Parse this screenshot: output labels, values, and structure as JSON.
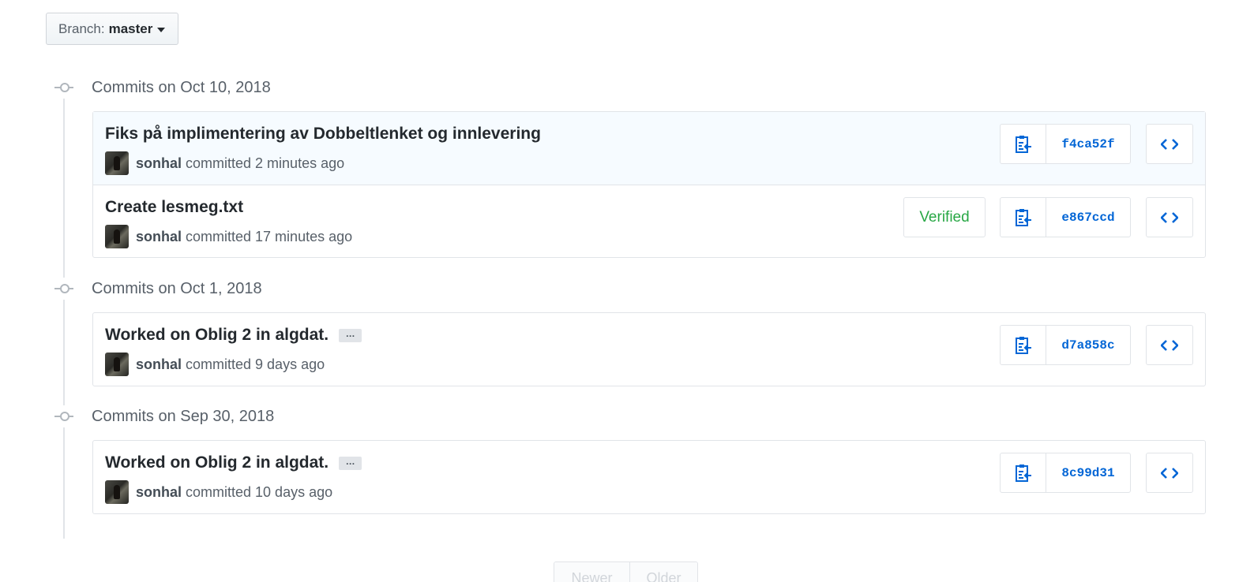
{
  "branch": {
    "label": "Branch:",
    "value": "master"
  },
  "groups": [
    {
      "date": "Commits on Oct 10, 2018",
      "commits": [
        {
          "title": "Fiks på implimentering av Dobbeltlenket og innlevering",
          "author": "sonhal",
          "time": "committed 2 minutes ago",
          "sha": "f4ca52f",
          "verified": "",
          "has_more": false
        },
        {
          "title": "Create lesmeg.txt",
          "author": "sonhal",
          "time": "committed 17 minutes ago",
          "sha": "e867ccd",
          "verified": "Verified",
          "has_more": false
        }
      ]
    },
    {
      "date": "Commits on Oct 1, 2018",
      "commits": [
        {
          "title": "Worked on Oblig 2 in algdat.",
          "author": "sonhal",
          "time": "committed 9 days ago",
          "sha": "d7a858c",
          "verified": "",
          "has_more": true,
          "more_label": "…"
        }
      ]
    },
    {
      "date": "Commits on Sep 30, 2018",
      "commits": [
        {
          "title": "Worked on Oblig 2 in algdat.",
          "author": "sonhal",
          "time": "committed 10 days ago",
          "sha": "8c99d31",
          "verified": "",
          "has_more": true,
          "more_label": "…"
        }
      ]
    }
  ],
  "pagination": {
    "newer": "Newer",
    "older": "Older"
  },
  "icons": {
    "copy": "clipboard-icon",
    "browse": "code-icon",
    "timeline": "git-commit-icon",
    "caret": "caret-down-icon"
  },
  "colors": {
    "link": "#0366d6",
    "verified": "#28a745",
    "highlight_row": "#f6fbff"
  }
}
